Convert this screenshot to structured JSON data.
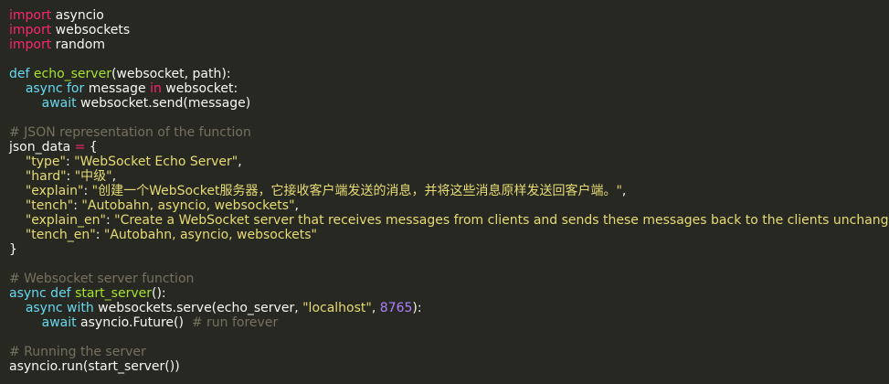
{
  "editor": {
    "colors": {
      "background": "#272822",
      "text": "#f8f8f2",
      "keyword_import": "#f92672",
      "keyword": "#66d9ef",
      "function_name": "#a6e22e",
      "string": "#e6db74",
      "number": "#ae81ff",
      "comment": "#75715e"
    },
    "lines": [
      [
        {
          "t": "kw",
          "v": "import"
        },
        {
          "t": "plain",
          "v": " asyncio"
        }
      ],
      [
        {
          "t": "kw",
          "v": "import"
        },
        {
          "t": "plain",
          "v": " websockets"
        }
      ],
      [
        {
          "t": "kw",
          "v": "import"
        },
        {
          "t": "plain",
          "v": " random"
        }
      ],
      [],
      [
        {
          "t": "kw2",
          "v": "def"
        },
        {
          "t": "plain",
          "v": " "
        },
        {
          "t": "fn",
          "v": "echo_server"
        },
        {
          "t": "plain",
          "v": "(websocket, path):"
        }
      ],
      [
        {
          "t": "plain",
          "v": "    "
        },
        {
          "t": "kw2",
          "v": "async for"
        },
        {
          "t": "plain",
          "v": " message "
        },
        {
          "t": "kw",
          "v": "in"
        },
        {
          "t": "plain",
          "v": " websocket:"
        }
      ],
      [
        {
          "t": "plain",
          "v": "        "
        },
        {
          "t": "kw2",
          "v": "await"
        },
        {
          "t": "plain",
          "v": " websocket.send(message)"
        }
      ],
      [],
      [
        {
          "t": "cmt",
          "v": "# JSON representation of the function"
        }
      ],
      [
        {
          "t": "plain",
          "v": "json_data "
        },
        {
          "t": "kw",
          "v": "="
        },
        {
          "t": "plain",
          "v": " {"
        }
      ],
      [
        {
          "t": "plain",
          "v": "    "
        },
        {
          "t": "str",
          "v": "\"type\""
        },
        {
          "t": "plain",
          "v": ": "
        },
        {
          "t": "str",
          "v": "\"WebSocket Echo Server\""
        },
        {
          "t": "plain",
          "v": ","
        }
      ],
      [
        {
          "t": "plain",
          "v": "    "
        },
        {
          "t": "str",
          "v": "\"hard\""
        },
        {
          "t": "plain",
          "v": ": "
        },
        {
          "t": "str",
          "v": "\"中级\""
        },
        {
          "t": "plain",
          "v": ","
        }
      ],
      [
        {
          "t": "plain",
          "v": "    "
        },
        {
          "t": "str",
          "v": "\"explain\""
        },
        {
          "t": "plain",
          "v": ": "
        },
        {
          "t": "str",
          "v": "\"创建一个WebSocket服务器，它接收客户端发送的消息，并将这些消息原样发送回客户端。\""
        },
        {
          "t": "plain",
          "v": ","
        }
      ],
      [
        {
          "t": "plain",
          "v": "    "
        },
        {
          "t": "str",
          "v": "\"tench\""
        },
        {
          "t": "plain",
          "v": ": "
        },
        {
          "t": "str",
          "v": "\"Autobahn, asyncio, websockets\""
        },
        {
          "t": "plain",
          "v": ","
        }
      ],
      [
        {
          "t": "plain",
          "v": "    "
        },
        {
          "t": "str",
          "v": "\"explain_en\""
        },
        {
          "t": "plain",
          "v": ": "
        },
        {
          "t": "str",
          "v": "\"Create a WebSocket server that receives messages from clients and sends these messages back to the clients unchanged.\""
        },
        {
          "t": "plain",
          "v": ","
        }
      ],
      [
        {
          "t": "plain",
          "v": "    "
        },
        {
          "t": "str",
          "v": "\"tench_en\""
        },
        {
          "t": "plain",
          "v": ": "
        },
        {
          "t": "str",
          "v": "\"Autobahn, asyncio, websockets\""
        }
      ],
      [
        {
          "t": "plain",
          "v": "}"
        }
      ],
      [],
      [
        {
          "t": "cmt",
          "v": "# Websocket server function"
        }
      ],
      [
        {
          "t": "kw2",
          "v": "async def"
        },
        {
          "t": "plain",
          "v": " "
        },
        {
          "t": "fn",
          "v": "start_server"
        },
        {
          "t": "plain",
          "v": "():"
        }
      ],
      [
        {
          "t": "plain",
          "v": "    "
        },
        {
          "t": "kw2",
          "v": "async with"
        },
        {
          "t": "plain",
          "v": " websockets.serve(echo_server, "
        },
        {
          "t": "str",
          "v": "\"localhost\""
        },
        {
          "t": "plain",
          "v": ", "
        },
        {
          "t": "num",
          "v": "8765"
        },
        {
          "t": "plain",
          "v": "):"
        }
      ],
      [
        {
          "t": "plain",
          "v": "        "
        },
        {
          "t": "kw2",
          "v": "await"
        },
        {
          "t": "plain",
          "v": " asyncio.Future()  "
        },
        {
          "t": "cmt",
          "v": "# run forever"
        }
      ],
      [],
      [
        {
          "t": "cmt",
          "v": "# Running the server"
        }
      ],
      [
        {
          "t": "plain",
          "v": "asyncio.run(start_server())"
        }
      ]
    ]
  }
}
